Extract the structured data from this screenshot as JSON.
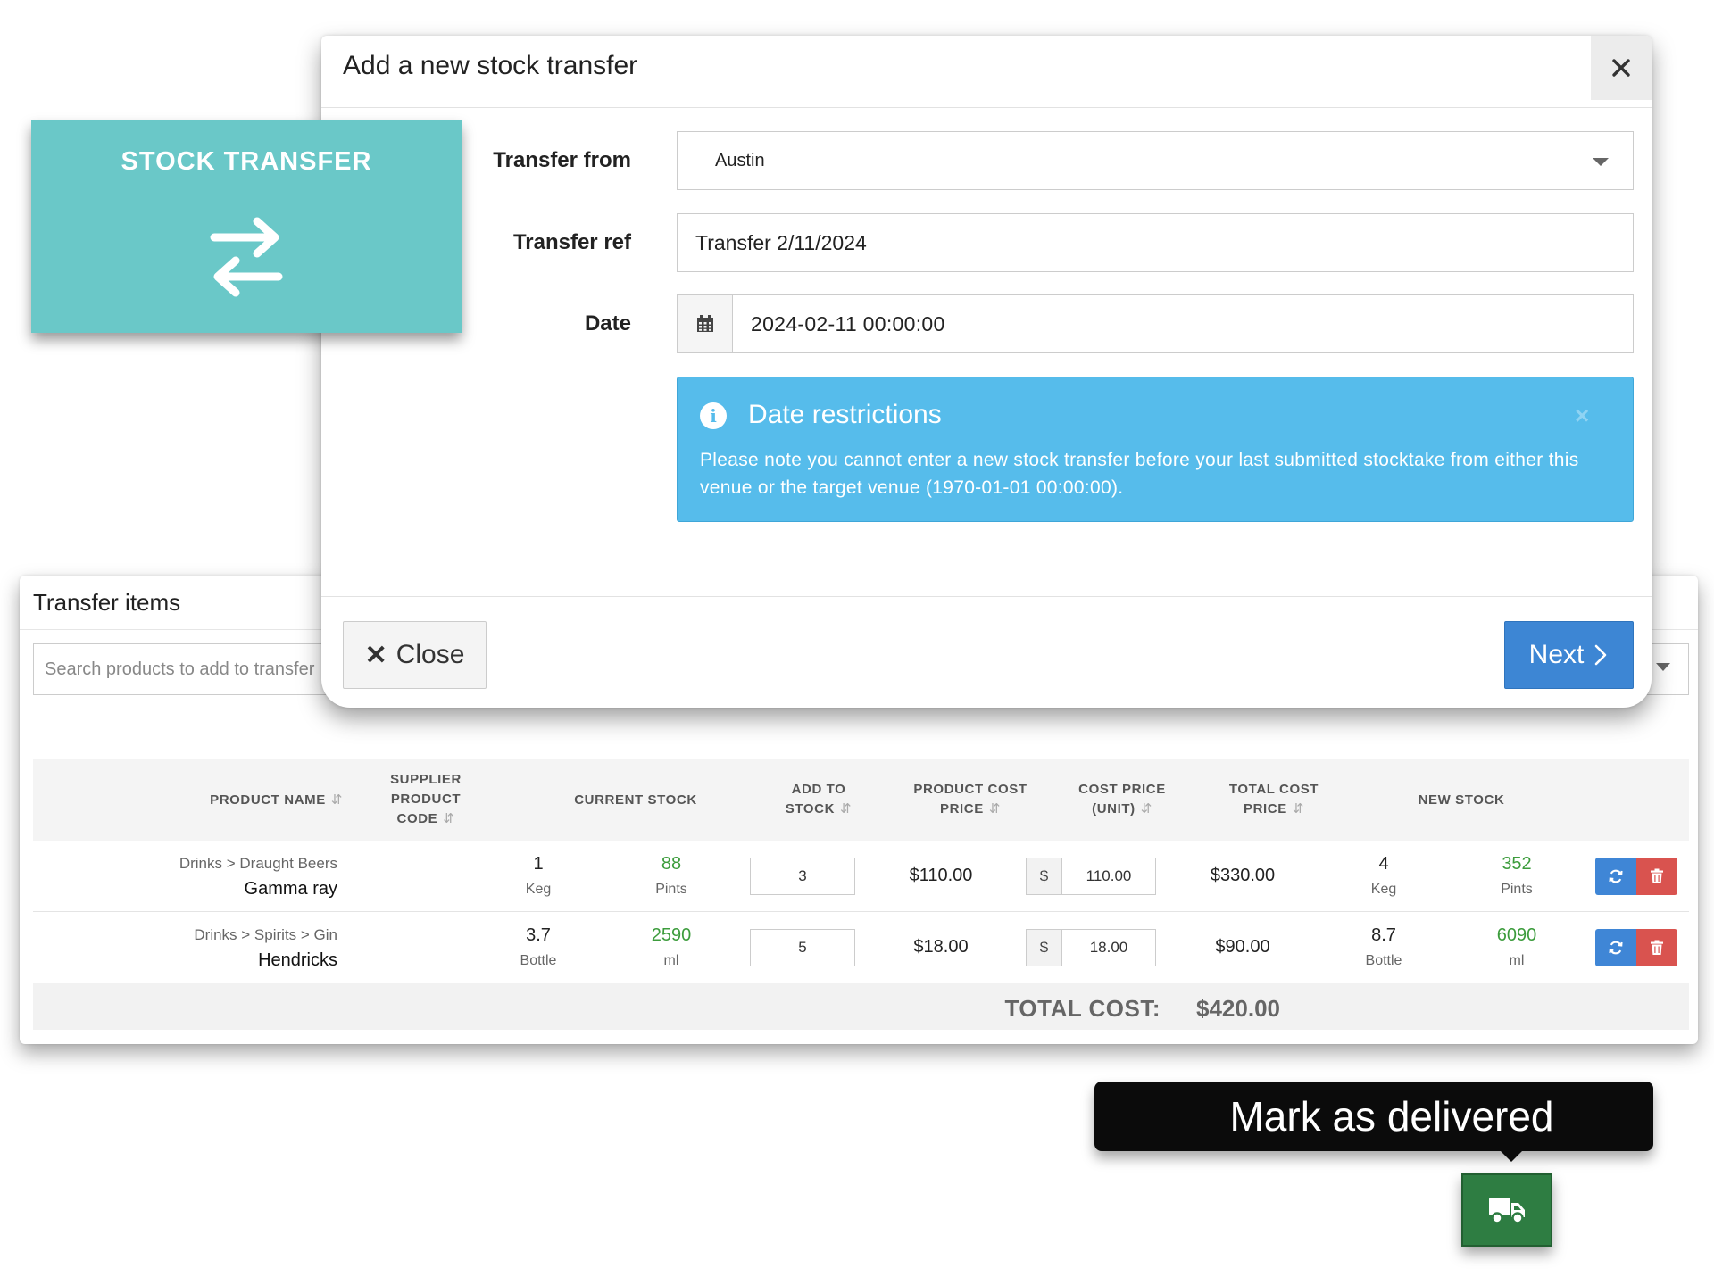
{
  "tile": {
    "title": "STOCK TRANSFER",
    "icon": "transfer-arrows-icon",
    "color": "#6ac8c8"
  },
  "modal": {
    "title": "Add a new stock transfer",
    "close_icon": "close-icon",
    "fields": {
      "transfer_from": {
        "label": "Transfer from",
        "value": "Austin"
      },
      "transfer_ref": {
        "label": "Transfer ref",
        "value": "Transfer 2/11/2024"
      },
      "date": {
        "label": "Date",
        "value": "2024-02-11 00:00:00",
        "icon": "calendar-icon"
      }
    },
    "alert": {
      "title": "Date restrictions",
      "text": "Please note you cannot enter a new stock transfer before your last submitted stocktake from either this venue or the target venue (1970-01-01 00:00:00).",
      "icon": "info-icon",
      "dismiss": "×",
      "color": "#56bceb"
    },
    "footer": {
      "close_label": "Close",
      "close_glyph": "✕",
      "next_label": "Next",
      "next_glyph": "›"
    }
  },
  "items": {
    "title": "Transfer items",
    "search": {
      "placeholder": "Search products to add to transfer"
    },
    "columns": {
      "product_name": "PRODUCT NAME",
      "supplier_code_1": "SUPPLIER",
      "supplier_code_2": "PRODUCT",
      "supplier_code_3": "CODE",
      "current_stock": "CURRENT STOCK",
      "add_to_stock_1": "ADD TO",
      "add_to_stock_2": "STOCK",
      "product_cost_1": "PRODUCT COST",
      "product_cost_2": "PRICE",
      "cost_unit_1": "COST PRICE",
      "cost_unit_2": "(UNIT)",
      "total_cost_1": "TOTAL COST",
      "total_cost_2": "PRICE",
      "new_stock": "NEW STOCK",
      "sort_glyph": "⇵"
    },
    "rows": [
      {
        "category": "Drinks > Draught Beers",
        "name": "Gamma ray",
        "current_qty": "1",
        "current_unit": "Keg",
        "current_alt_qty": "88",
        "current_alt_unit": "Pints",
        "add_qty": "3",
        "product_cost": "$110.00",
        "currency": "$",
        "unit_cost": "110.00",
        "total_cost": "$330.00",
        "new_qty": "4",
        "new_unit": "Keg",
        "new_alt_qty": "352",
        "new_alt_unit": "Pints"
      },
      {
        "category": "Drinks > Spirits > Gin",
        "name": "Hendricks",
        "current_qty": "3.7",
        "current_unit": "Bottle",
        "current_alt_qty": "2590",
        "current_alt_unit": "ml",
        "add_qty": "5",
        "product_cost": "$18.00",
        "currency": "$",
        "unit_cost": "18.00",
        "total_cost": "$90.00",
        "new_qty": "8.7",
        "new_unit": "Bottle",
        "new_alt_qty": "6090",
        "new_alt_unit": "ml"
      }
    ],
    "total_label": "TOTAL COST:",
    "total_value": "$420.00"
  },
  "tooltip": {
    "text": "Mark as delivered"
  },
  "delivered_button": {
    "icon": "truck-icon",
    "color": "#2e7d42"
  },
  "colors": {
    "primary": "#3d86d4",
    "danger": "#d9534f",
    "info": "#56bceb",
    "green_text": "#3c9c3c"
  }
}
